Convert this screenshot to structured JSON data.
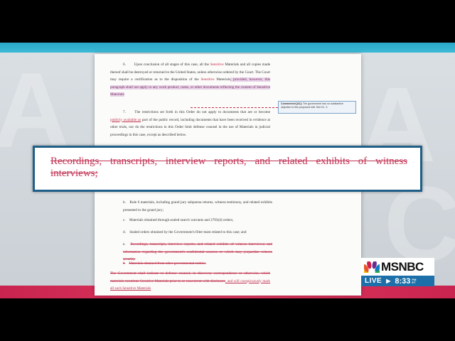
{
  "document": {
    "para6": {
      "number": "6.",
      "text_1": "Upon conclusion of all stages of this case, all the ",
      "text_link": "Sensitive",
      "text_2": " Materials and all copies made thereof shall be destroyed or returned to the United States, unless otherwise ordered by the Court. The Court may require a certification as to the disposition of the ",
      "text_link2": "Sensitive",
      "text_3": " Materials",
      "text_hl": ", provided, however, this paragraph shall not apply to any work product, notes, or other documents reflecting the content of Sensitive Materials"
    },
    "comment": {
      "label": "Commented [A1]:",
      "text": "The government has no substantive objection to this proposed edit. See Ex. 3."
    },
    "para7": {
      "number": "7.",
      "text_1": "The restrictions set forth in this Order do not apply to documents that are or become ",
      "text_link": "publicly available as",
      "text_2": " part of the public record, including documents that have been received in evidence at other trials, nor do the restrictions in this Order limit defense counsel in the use of Materials in judicial proceedings in this case, except as described below."
    },
    "list": [
      {
        "letter": "b.",
        "text": "Rule 6 materials, including grand jury subpoena returns, witness testimony, and related exhibits presented to the grand jury;",
        "style": "normal"
      },
      {
        "letter": "c.",
        "text": "Materials obtained through sealed search warrants and 2703(d) orders;",
        "style": "normal"
      },
      {
        "letter": "d.",
        "text": "Sealed orders obtained by the Government's filter team related to this case; and",
        "style": "normal"
      },
      {
        "letter": "e.",
        "text": "Recordings, transcripts, interview reports, and related exhibits of witness interviews; and information regarding the government's confidential sources or which may jeopardize witness security.",
        "style": "strike"
      },
      {
        "letter": "f.",
        "text": "Materials obtained from other governmental entities",
        "style": "strike"
      }
    ],
    "closing_1": "The Government shall indicate to defense counsel, in discovery correspondence or otherwise, which materials constitute Sensitive Materials prior to or concurrent with disclosure",
    "closing_2": ", and will conspicuously mark all such Sensitive Materials"
  },
  "callout": {
    "text": "Recordings, transcripts, interview reports, and related exhibits of witness interviews;"
  },
  "network": {
    "logo": "MSNBC",
    "live": "LIVE",
    "arrow": "▶",
    "time": "8:33",
    "tz_top": "PM",
    "tz_bottom": "ET"
  },
  "colors": {
    "accent_red": "#c0304a",
    "frame_blue": "#2aa7c9",
    "live_blue": "#1c6fa8"
  }
}
